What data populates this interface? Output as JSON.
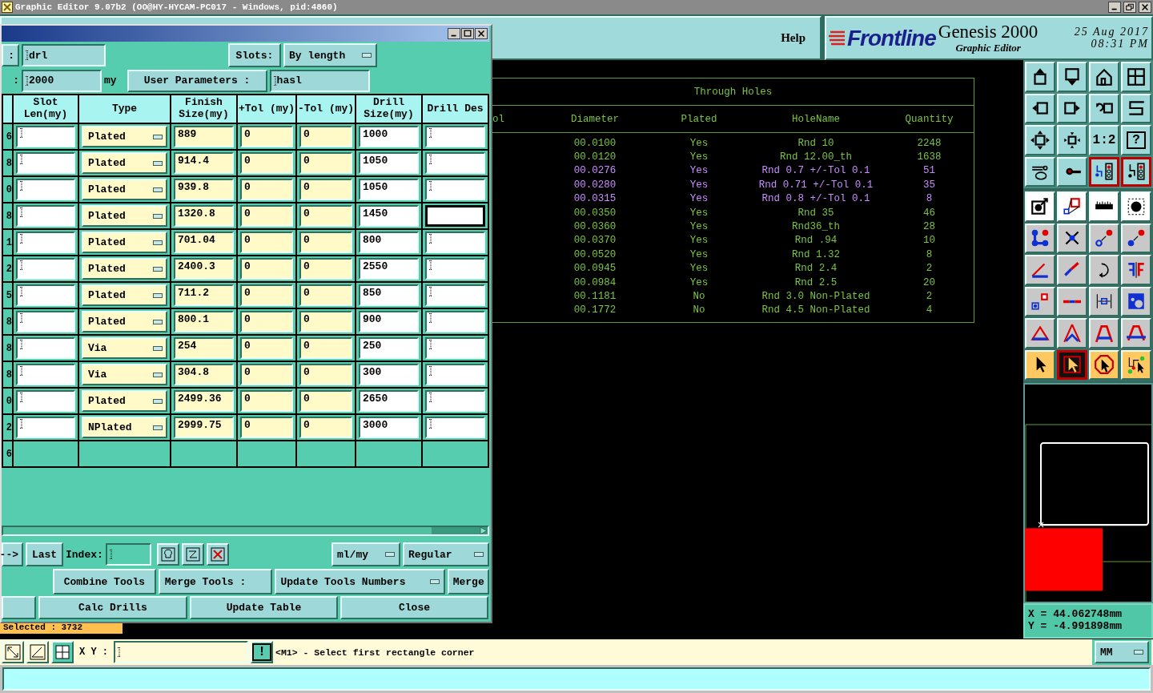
{
  "title_bar": {
    "title": "Graphic Editor 9.07b2 (OO@HY-HYCAM-PC017 - Windows, pid:4860)"
  },
  "header": {
    "help": "Help",
    "logo": "Frontline",
    "product": "Genesis 2000",
    "subtitle": "Graphic Editor",
    "date": "25 Aug 2017",
    "time": "08:31 PM"
  },
  "dialog": {
    "name_label": ":",
    "name_value": "drl",
    "slots_label": "Slots:",
    "slots_value": "By length",
    "size_label": ":",
    "size_value": "2000",
    "size_unit": "my",
    "user_params": "User Parameters :",
    "user_params_value": "hasl",
    "columns": [
      "Slot Len(my)",
      "Type",
      "Finish Size(my)",
      "+Tol (my)",
      "-Tol (my)",
      "Drill Size(my)",
      "Drill Des"
    ],
    "rows": [
      {
        "column_1": "6",
        "type": "Plated",
        "finish": "889",
        "plus_tol": "0",
        "minus_tol": "0",
        "drill_size": "1000",
        "focused": false
      },
      {
        "column_1": "8",
        "type": "Plated",
        "finish": "914.4",
        "plus_tol": "0",
        "minus_tol": "0",
        "drill_size": "1050",
        "focused": false
      },
      {
        "column_1": "0",
        "type": "Plated",
        "finish": "939.8",
        "plus_tol": "0",
        "minus_tol": "0",
        "drill_size": "1050",
        "focused": false
      },
      {
        "column_1": "8",
        "type": "Plated",
        "finish": "1320.8",
        "plus_tol": "0",
        "minus_tol": "0",
        "drill_size": "1450",
        "focused": true
      },
      {
        "column_1": "1",
        "type": "Plated",
        "finish": "701.04",
        "plus_tol": "0",
        "minus_tol": "0",
        "drill_size": "800",
        "focused": false
      },
      {
        "column_1": "2",
        "type": "Plated",
        "finish": "2400.3",
        "plus_tol": "0",
        "minus_tol": "0",
        "drill_size": "2550",
        "focused": false
      },
      {
        "column_1": "5",
        "type": "Plated",
        "finish": "711.2",
        "plus_tol": "0",
        "minus_tol": "0",
        "drill_size": "850",
        "focused": false
      },
      {
        "column_1": "8",
        "type": "Plated",
        "finish": "800.1",
        "plus_tol": "0",
        "minus_tol": "0",
        "drill_size": "900",
        "focused": false
      },
      {
        "column_1": "8",
        "type": "Via",
        "finish": "254",
        "plus_tol": "0",
        "minus_tol": "0",
        "drill_size": "250",
        "focused": false
      },
      {
        "column_1": "8",
        "type": "Via",
        "finish": "304.8",
        "plus_tol": "0",
        "minus_tol": "0",
        "drill_size": "300",
        "focused": false
      },
      {
        "column_1": "0",
        "type": "Plated",
        "finish": "2499.36",
        "plus_tol": "0",
        "minus_tol": "0",
        "drill_size": "2650",
        "focused": false
      },
      {
        "column_1": "2",
        "type": "NPlated",
        "finish": "2999.75",
        "plus_tol": "0",
        "minus_tol": "0",
        "drill_size": "3000",
        "focused": false
      }
    ],
    "total": "6",
    "nav": {
      "next": "-->",
      "last": "Last",
      "index_label": "Index:",
      "units": "ml/my",
      "mode": "Regular"
    },
    "merge": {
      "combine": "Combine Tools",
      "label": "Merge Tools :",
      "mode": "Update Tools Numbers",
      "merge": "Merge"
    },
    "actions": [
      "Calc Drills",
      "Update Table",
      "Close"
    ]
  },
  "holes_table": {
    "title": "Through Holes",
    "columns": [
      "ol",
      "Diameter",
      "Plated",
      "HoleName",
      "Quantity"
    ],
    "rows": [
      {
        "diameter": "00.0100",
        "plated": "Yes",
        "hole_name": "Rnd 10",
        "quantity": "2248",
        "color": "#7cc440"
      },
      {
        "diameter": "00.0120",
        "plated": "Yes",
        "hole_name": "Rnd 12.00_th",
        "quantity": "1638",
        "color": "#7cc440"
      },
      {
        "diameter": "00.0276",
        "plated": "Yes",
        "hole_name": "Rnd 0.7 +/-Tol 0.1",
        "quantity": "51",
        "color": "#c88cff"
      },
      {
        "diameter": "00.0280",
        "plated": "Yes",
        "hole_name": "Rnd 0.71 +/-Tol 0.1",
        "quantity": "35",
        "color": "#c88cff"
      },
      {
        "diameter": "00.0315",
        "plated": "Yes",
        "hole_name": "Rnd 0.8 +/-Tol 0.1",
        "quantity": "8",
        "color": "#c88cff"
      },
      {
        "diameter": "00.0350",
        "plated": "Yes",
        "hole_name": "Rnd 35",
        "quantity": "46",
        "color": "#7cc440"
      },
      {
        "diameter": "00.0360",
        "plated": "Yes",
        "hole_name": "Rnd36_th",
        "quantity": "28",
        "color": "#7cc440"
      },
      {
        "diameter": "00.0370",
        "plated": "Yes",
        "hole_name": "Rnd .94",
        "quantity": "10",
        "color": "#7cc440"
      },
      {
        "diameter": "00.0520",
        "plated": "Yes",
        "hole_name": "Rnd 1.32",
        "quantity": "8",
        "color": "#7cc440"
      },
      {
        "diameter": "00.0945",
        "plated": "Yes",
        "hole_name": "Rnd 2.4",
        "quantity": "2",
        "color": "#7cc440"
      },
      {
        "diameter": "00.0984",
        "plated": "Yes",
        "hole_name": "Rnd 2.5",
        "quantity": "20",
        "color": "#7cc440"
      },
      {
        "diameter": "00.1181",
        "plated": "No",
        "hole_name": "Rnd 3.0 Non-Plated",
        "quantity": "2",
        "color": "#7cc440"
      },
      {
        "diameter": "00.1772",
        "plated": "No",
        "hole_name": "Rnd 4.5 Non-Plated",
        "quantity": "4",
        "color": "#7cc440"
      }
    ]
  },
  "selected_count": "Selected : 3732",
  "tools": [
    {
      "kind": "view",
      "selected": false
    },
    {
      "kind": "view",
      "selected": false
    },
    {
      "kind": "view",
      "selected": false
    },
    {
      "kind": "view",
      "selected": false
    },
    {
      "kind": "view",
      "selected": false
    },
    {
      "kind": "view",
      "selected": false
    },
    {
      "kind": "view",
      "selected": false
    },
    {
      "kind": "view",
      "selected": false
    },
    {
      "kind": "view",
      "selected": false
    },
    {
      "kind": "view",
      "selected": false
    },
    {
      "kind": "view",
      "selected": false,
      "label": "1:2"
    },
    {
      "kind": "view",
      "selected": false,
      "label": "?"
    },
    {
      "kind": "view",
      "selected": false
    },
    {
      "kind": "view",
      "selected": false
    },
    {
      "kind": "view",
      "selected": true
    },
    {
      "kind": "view",
      "selected": true
    },
    {
      "kind": "white",
      "selected": false
    },
    {
      "kind": "white",
      "selected": false
    },
    {
      "kind": "white",
      "selected": false
    },
    {
      "kind": "white",
      "selected": false
    },
    {
      "kind": "edit",
      "selected": false
    },
    {
      "kind": "edit",
      "selected": false
    },
    {
      "kind": "edit",
      "selected": false
    },
    {
      "kind": "edit",
      "selected": false
    },
    {
      "kind": "edit",
      "selected": false
    },
    {
      "kind": "edit",
      "selected": false
    },
    {
      "kind": "edit",
      "selected": false
    },
    {
      "kind": "edit",
      "selected": false
    },
    {
      "kind": "edit",
      "selected": false
    },
    {
      "kind": "edit",
      "selected": false
    },
    {
      "kind": "edit",
      "selected": false
    },
    {
      "kind": "edit",
      "selected": false
    },
    {
      "kind": "edit",
      "selected": false
    },
    {
      "kind": "edit",
      "selected": false
    },
    {
      "kind": "edit",
      "selected": false
    },
    {
      "kind": "edit",
      "selected": false
    },
    {
      "kind": "select",
      "selected": false
    },
    {
      "kind": "select",
      "selected": true
    },
    {
      "kind": "select",
      "selected": false
    },
    {
      "kind": "select",
      "selected": false
    }
  ],
  "coordinates": {
    "x": "X = 44.062748mm",
    "y": "Y = -4.991898mm"
  },
  "status_bar": {
    "xy_label": "X Y :",
    "alert": "!",
    "message": "<M1> - Select first rectangle corner",
    "units": "MM"
  }
}
